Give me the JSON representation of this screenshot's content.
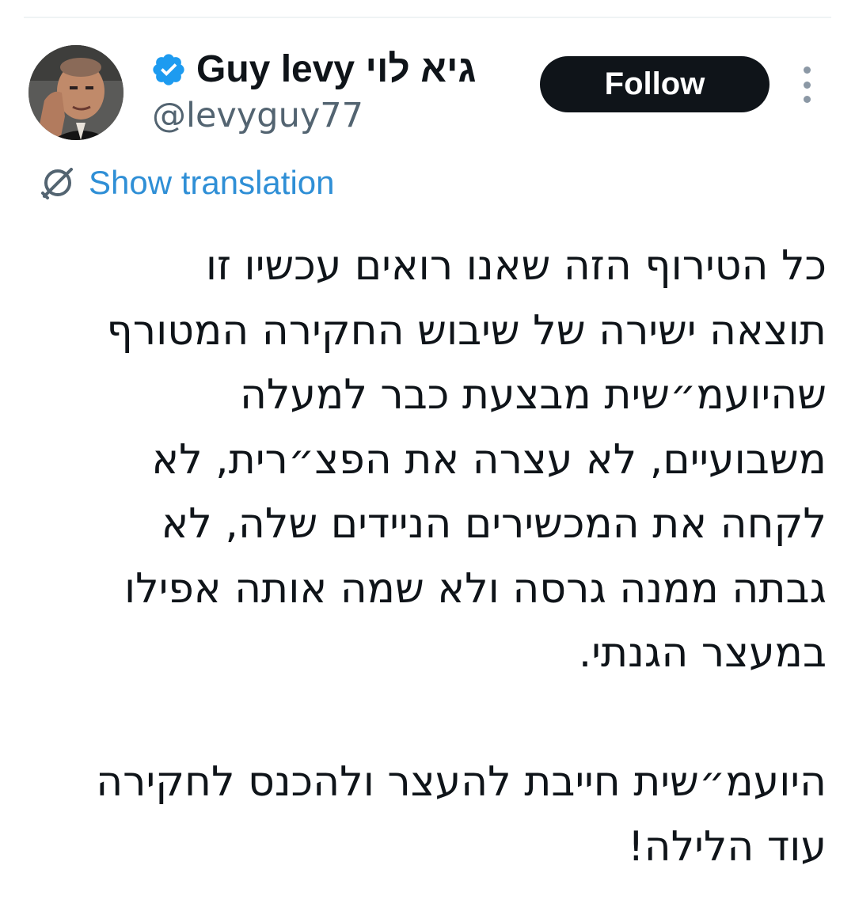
{
  "author": {
    "display_name": "Guy levy גיא לוי",
    "handle": "@levyguy77",
    "verified": true,
    "verified_color": "#1d9bf0"
  },
  "follow_button": {
    "label": "Follow"
  },
  "more_menu": {
    "icon": "more-vertical-icon"
  },
  "translation": {
    "icon": "globe-translate-icon",
    "label": "Show translation"
  },
  "tweet": {
    "paragraphs": [
      [
        "כל הטירוף הזה שאנו רואים עכשיו זו",
        "תוצאה ישירה של שיבוש החקירה המטורף",
        "שהיועמ״שית מבצעת כבר למעלה",
        "משבועיים, לא עצרה את הפצ״רית, לא",
        "לקחה את המכשירים הניידים שלה, לא",
        "גבתה ממנה גרסה ולא שמה אותה אפילו",
        "במעצר הגנתי."
      ],
      [
        "היועמ״שית חייבת להעצר ולהכנס לחקירה",
        "עוד הלילה!"
      ]
    ]
  }
}
